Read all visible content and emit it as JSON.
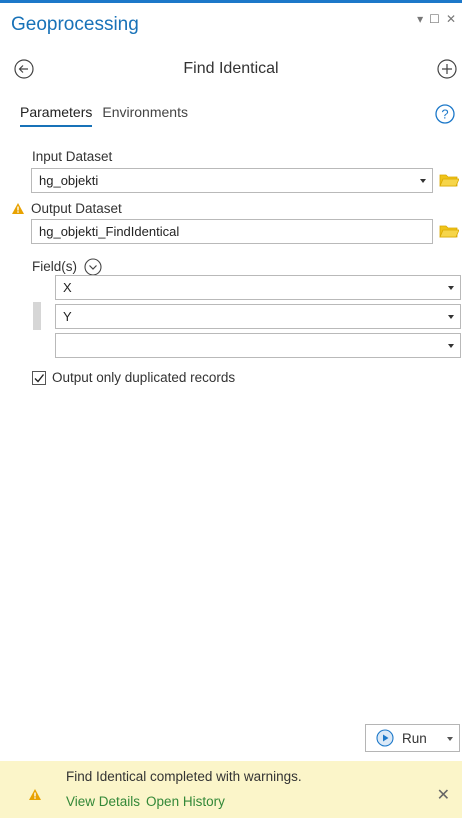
{
  "pane": {
    "title": "Geoprocessing",
    "controls": {
      "pin": "▾",
      "restore": "☐",
      "close": "✕"
    }
  },
  "tool": {
    "title": "Find Identical",
    "back_icon": "back-arrow-icon",
    "add_icon": "plus-circle-icon"
  },
  "tabs": [
    {
      "label": "Parameters",
      "active": true
    },
    {
      "label": "Environments",
      "active": false
    }
  ],
  "params": {
    "input_dataset": {
      "label": "Input Dataset",
      "value": "hg_objekti"
    },
    "output_dataset": {
      "label": "Output Dataset",
      "value": "hg_objekti_FindIdentical",
      "has_warning": true
    },
    "fields": {
      "label": "Field(s)",
      "rows": [
        "X",
        "Y",
        ""
      ]
    },
    "only_duplicates": {
      "label": "Output only duplicated records",
      "checked": true
    }
  },
  "run": {
    "label": "Run"
  },
  "message": {
    "text": "Find Identical completed with warnings.",
    "links": [
      "View Details",
      "Open History"
    ]
  },
  "colors": {
    "accent": "#1872b8",
    "warning": "#e8a200",
    "folder": "#f0c419",
    "link": "#338838",
    "message_bg": "#fbf5c9"
  }
}
